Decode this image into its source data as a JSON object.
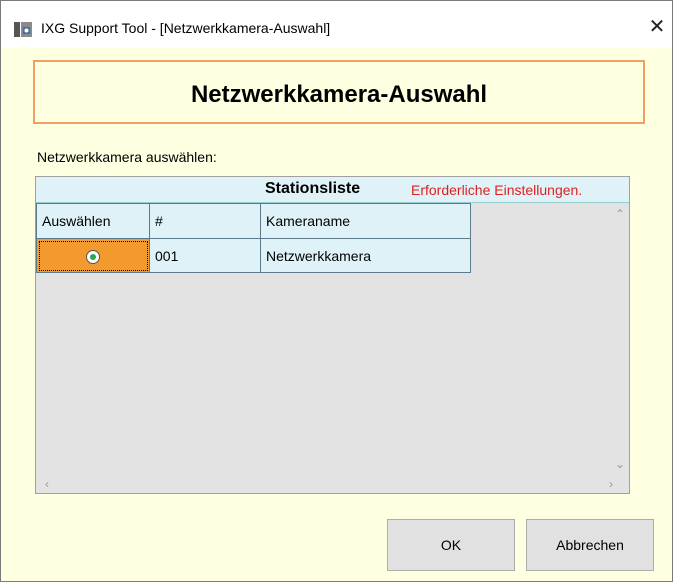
{
  "window": {
    "title": "IXG Support Tool - [Netzwerkkamera-Auswahl]",
    "close_label": "✕"
  },
  "header": {
    "title": "Netzwerkkamera-Auswahl"
  },
  "selection": {
    "label": "Netzwerkkamera auswählen:"
  },
  "grid": {
    "title": "Stationsliste",
    "required_note": "Erforderliche Einstellungen.",
    "columns": [
      "Auswählen",
      "#",
      "Kameraname"
    ],
    "rows": [
      {
        "selected": true,
        "number": "001",
        "name": "Netzwerkkamera"
      }
    ]
  },
  "buttons": {
    "ok": "OK",
    "cancel": "Abbrechen"
  },
  "colors": {
    "background": "#ffffe1",
    "header_border": "#f0a060",
    "selected_cell": "#f39a2e",
    "grid_header": "#dff2f7",
    "required_text": "#e02020"
  }
}
